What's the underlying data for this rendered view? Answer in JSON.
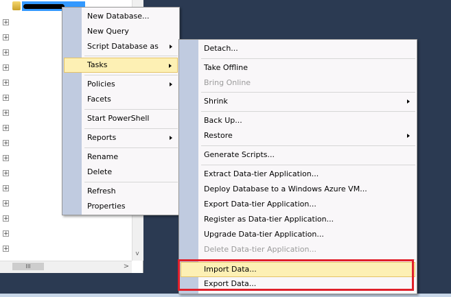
{
  "object_explorer": {
    "expander_glyph": "+",
    "rows": 16,
    "hscroll_thumb_glyph": "III",
    "hscroll_right_glyph": ">",
    "vscroll_down_glyph": "v"
  },
  "context_menu": {
    "items": [
      {
        "label": "New Database...",
        "submenu": false
      },
      {
        "label": "New Query",
        "submenu": false
      },
      {
        "label": "Script Database as",
        "submenu": true
      },
      {
        "label": "Tasks",
        "submenu": true,
        "highlighted": true
      },
      {
        "label": "Policies",
        "submenu": true
      },
      {
        "label": "Facets",
        "submenu": false
      },
      {
        "label": "Start PowerShell",
        "submenu": false
      },
      {
        "label": "Reports",
        "submenu": true
      },
      {
        "label": "Rename",
        "submenu": false
      },
      {
        "label": "Delete",
        "submenu": false
      },
      {
        "label": "Refresh",
        "submenu": false
      },
      {
        "label": "Properties",
        "submenu": false
      }
    ]
  },
  "tasks_menu": {
    "items": [
      {
        "label": "Detach...",
        "submenu": false
      },
      {
        "label": "Take Offline",
        "submenu": false
      },
      {
        "label": "Bring Online",
        "submenu": false,
        "disabled": true
      },
      {
        "label": "Shrink",
        "submenu": true
      },
      {
        "label": "Back Up...",
        "submenu": false
      },
      {
        "label": "Restore",
        "submenu": true
      },
      {
        "label": "Generate Scripts...",
        "submenu": false
      },
      {
        "label": "Extract Data-tier Application...",
        "submenu": false
      },
      {
        "label": "Deploy Database to a Windows Azure VM...",
        "submenu": false
      },
      {
        "label": "Export Data-tier Application...",
        "submenu": false
      },
      {
        "label": "Register as Data-tier Application...",
        "submenu": false
      },
      {
        "label": "Upgrade Data-tier Application...",
        "submenu": false
      },
      {
        "label": "Delete Data-tier Application...",
        "submenu": false,
        "disabled": true
      },
      {
        "label": "Import Data...",
        "submenu": false,
        "highlighted": true
      },
      {
        "label": "Export Data...",
        "submenu": false
      }
    ]
  },
  "colors": {
    "desktop": "#2b3a52",
    "menu_bg": "#f9f7f9",
    "menu_gutter": "#c0cbe0",
    "highlight": "#fdf0b4",
    "annotation_box": "#e0202a"
  }
}
